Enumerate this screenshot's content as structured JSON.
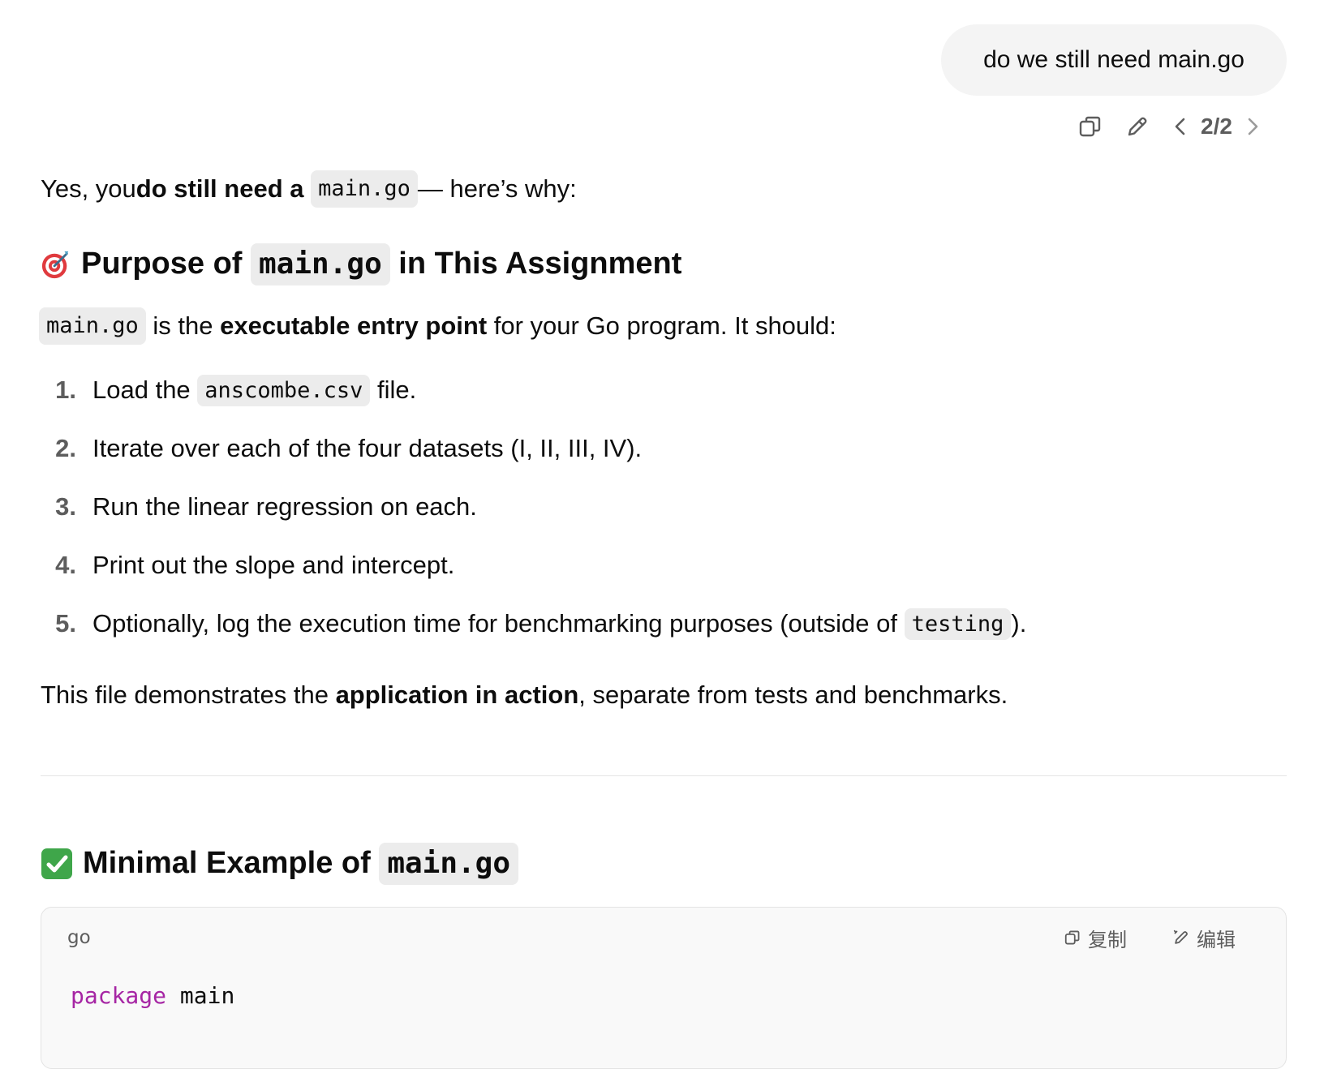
{
  "user_message": "do we still need main.go",
  "message_actions": {
    "icons": [
      "copy-icon",
      "edit-icon",
      "chevron-left-icon",
      "chevron-right-icon"
    ],
    "pager": "2/2"
  },
  "intro": {
    "t1": "Yes, you ",
    "b1": "do still need a",
    "code": "main.go",
    "t2": " — here’s why:"
  },
  "section1": {
    "emoji": "target-icon",
    "title_pre": "Purpose of ",
    "title_code": "main.go",
    "title_post": " in This Assignment"
  },
  "section1_text": {
    "code": "main.go",
    "t1": " is the ",
    "b1": "executable entry point",
    "t2": " for your Go program. It should:"
  },
  "steps": [
    {
      "num": "1.",
      "pre": "Load the ",
      "code": "anscombe.csv",
      "post": " file."
    },
    {
      "num": "2.",
      "text": "Iterate over each of the four datasets (I, II, III, IV)."
    },
    {
      "num": "3.",
      "text": "Run the linear regression on each."
    },
    {
      "num": "4.",
      "text": "Print out the slope and intercept."
    },
    {
      "num": "5.",
      "pre": "Optionally, log the execution time for benchmarking purposes (outside of ",
      "code": "testing",
      "post": ")."
    }
  ],
  "summary": {
    "t1": "This file demonstrates the ",
    "b1": "application in action",
    "t2": ", separate from tests and benchmarks."
  },
  "section2": {
    "emoji": "check-mark-icon",
    "title_pre": "Minimal Example of ",
    "title_code": "main.go"
  },
  "codeblock": {
    "lang": "go",
    "copy_label": "复制",
    "edit_label": "编辑",
    "line1_kw": "package",
    "line1_rest": " main"
  },
  "colors": {
    "text": "#0d0d0d",
    "muted": "#5d5d5d",
    "bubble_bg": "#f4f4f4",
    "inline_code_bg": "#ececec",
    "keyword": "#a626a4"
  }
}
